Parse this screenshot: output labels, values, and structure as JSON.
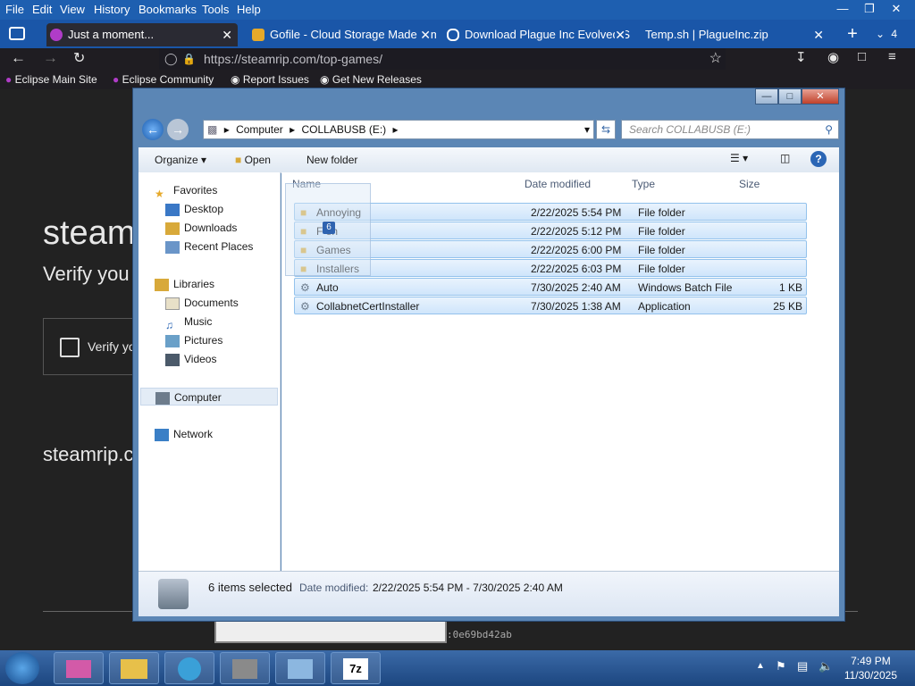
{
  "menubar": {
    "items": [
      "File",
      "Edit",
      "View",
      "History",
      "Bookmarks",
      "Tools",
      "Help"
    ]
  },
  "tabs": [
    {
      "title": "Just a moment...",
      "active": true
    },
    {
      "title": "Gofile - Cloud Storage Made Sim",
      "active": false
    },
    {
      "title": "Download Plague Inc Evolved S",
      "active": false
    },
    {
      "title": "Temp.sh | PlagueInc.zip",
      "active": false
    }
  ],
  "tab_count": "4",
  "url": "https://steamrip.com/top-games/",
  "bookmarks": [
    "Eclipse Main Site",
    "Eclipse Community",
    "Report Issues",
    "Get New Releases"
  ],
  "page_behind": {
    "heading": "steam",
    "subtext": "Verify you",
    "checkbox_label": "Verify yo",
    "footer_text": "steamrip.c",
    "ray_suffix": ":0e69bd42ab"
  },
  "explorer": {
    "breadcrumb": [
      "Computer",
      "COLLABUSB (E:)"
    ],
    "search_placeholder": "Search COLLABUSB (E:)",
    "toolbar": {
      "organize": "Organize",
      "open": "Open",
      "new_folder": "New folder"
    },
    "nav": {
      "favorites": "Favorites",
      "fav_items": [
        "Desktop",
        "Downloads",
        "Recent Places"
      ],
      "libraries": "Libraries",
      "lib_items": [
        "Documents",
        "Music",
        "Pictures",
        "Videos"
      ],
      "computer": "Computer",
      "network": "Network"
    },
    "columns": [
      "Name",
      "Date modified",
      "Type",
      "Size"
    ],
    "files": [
      {
        "name": "Annoying",
        "date": "2/22/2025 5:54 PM",
        "type": "File folder",
        "size": ""
      },
      {
        "name": "F   eh",
        "date": "2/22/2025 5:12 PM",
        "type": "File folder",
        "size": ""
      },
      {
        "name": "Games",
        "date": "2/22/2025 6:00 PM",
        "type": "File folder",
        "size": ""
      },
      {
        "name": "Installers",
        "date": "2/22/2025 6:03 PM",
        "type": "File folder",
        "size": ""
      },
      {
        "name": "Auto",
        "date": "7/30/2025 2:40 AM",
        "type": "Windows Batch File",
        "size": "1 KB"
      },
      {
        "name": "CollabnetCertInstaller",
        "date": "7/30/2025 1:38 AM",
        "type": "Application",
        "size": "25 KB"
      }
    ],
    "drag_count": "6",
    "status": {
      "selected": "6 items selected",
      "date_label": "Date modified:",
      "date_range": "2/22/2025 5:54 PM - 7/30/2025 2:40 AM"
    }
  },
  "taskbar": {
    "time": "7:49 PM",
    "date": "11/30/2025"
  }
}
